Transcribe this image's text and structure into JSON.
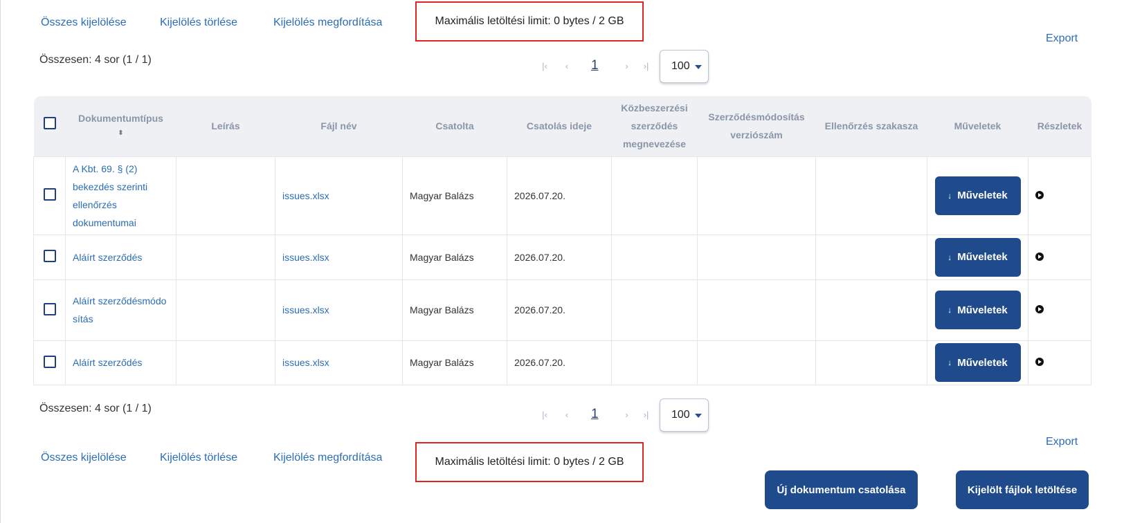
{
  "top_bar": {
    "select_all": "Összes kijelölése",
    "clear_selection": "Kijelölés törlése",
    "invert_selection": "Kijelölés megfordítása",
    "download_limit": "Maximális letöltési limit: 0 bytes / 2 GB",
    "export": "Export"
  },
  "summary": "Összesen: 4 sor (1 / 1)",
  "pager": {
    "first": "|‹",
    "prev": "‹",
    "page": "1",
    "next": "›",
    "last": "›|",
    "rows_per_page": "100"
  },
  "table": {
    "headers": {
      "doc_type": "Dokumentumtípus",
      "description": "Leírás",
      "file_name": "Fájl név",
      "attached_by": "Csatolta",
      "attached_at": "Csatolás ideje",
      "procurement_name": "Közbeszerzési szerződés megnevezése",
      "amendment_version": "Szerződésmódosítás verziószám",
      "check_phase": "Ellenőrzés szakasza",
      "actions": "Műveletek",
      "details": "Részletek"
    },
    "rows": [
      {
        "doc_type": "A Kbt. 69. § (2) bekezdés szerinti ellenőrzés dokumentumai",
        "description": "",
        "file_name": "issues.xlsx",
        "attached_by": "Magyar Balázs",
        "attached_at": "2026.07.20.",
        "procurement_name": "",
        "amendment_version": "",
        "check_phase": "",
        "actions": "Műveletek"
      },
      {
        "doc_type": "Aláírt szerződés",
        "description": "",
        "file_name": "issues.xlsx",
        "attached_by": "Magyar Balázs",
        "attached_at": "2026.07.20.",
        "procurement_name": "",
        "amendment_version": "",
        "check_phase": "",
        "actions": "Műveletek"
      },
      {
        "doc_type": "Aláírt szerződésmódosítás",
        "description": "",
        "file_name": "issues.xlsx",
        "attached_by": "Magyar Balázs",
        "attached_at": "2026.07.20.",
        "procurement_name": "",
        "amendment_version": "",
        "check_phase": "",
        "actions": "Műveletek"
      },
      {
        "doc_type": "Aláírt szerződés",
        "description": "",
        "file_name": "issues.xlsx",
        "attached_by": "Magyar Balázs",
        "attached_at": "2026.07.20.",
        "procurement_name": "",
        "amendment_version": "",
        "check_phase": "",
        "actions": "Műveletek"
      }
    ]
  },
  "bottom_bar": {
    "select_all": "Összes kijelölése",
    "clear_selection": "Kijelölés törlése",
    "invert_selection": "Kijelölés megfordítása",
    "download_limit": "Maximális letöltési limit: 0 bytes / 2 GB",
    "export": "Export",
    "attach_button": "Új dokumentum csatolása",
    "download_selected_button": "Kijelölt fájlok letöltése"
  },
  "colors": {
    "primary": "#1f4a8c",
    "link": "#2a6db5",
    "limit_border": "#e02424",
    "header_bg": "#eef0f4"
  }
}
